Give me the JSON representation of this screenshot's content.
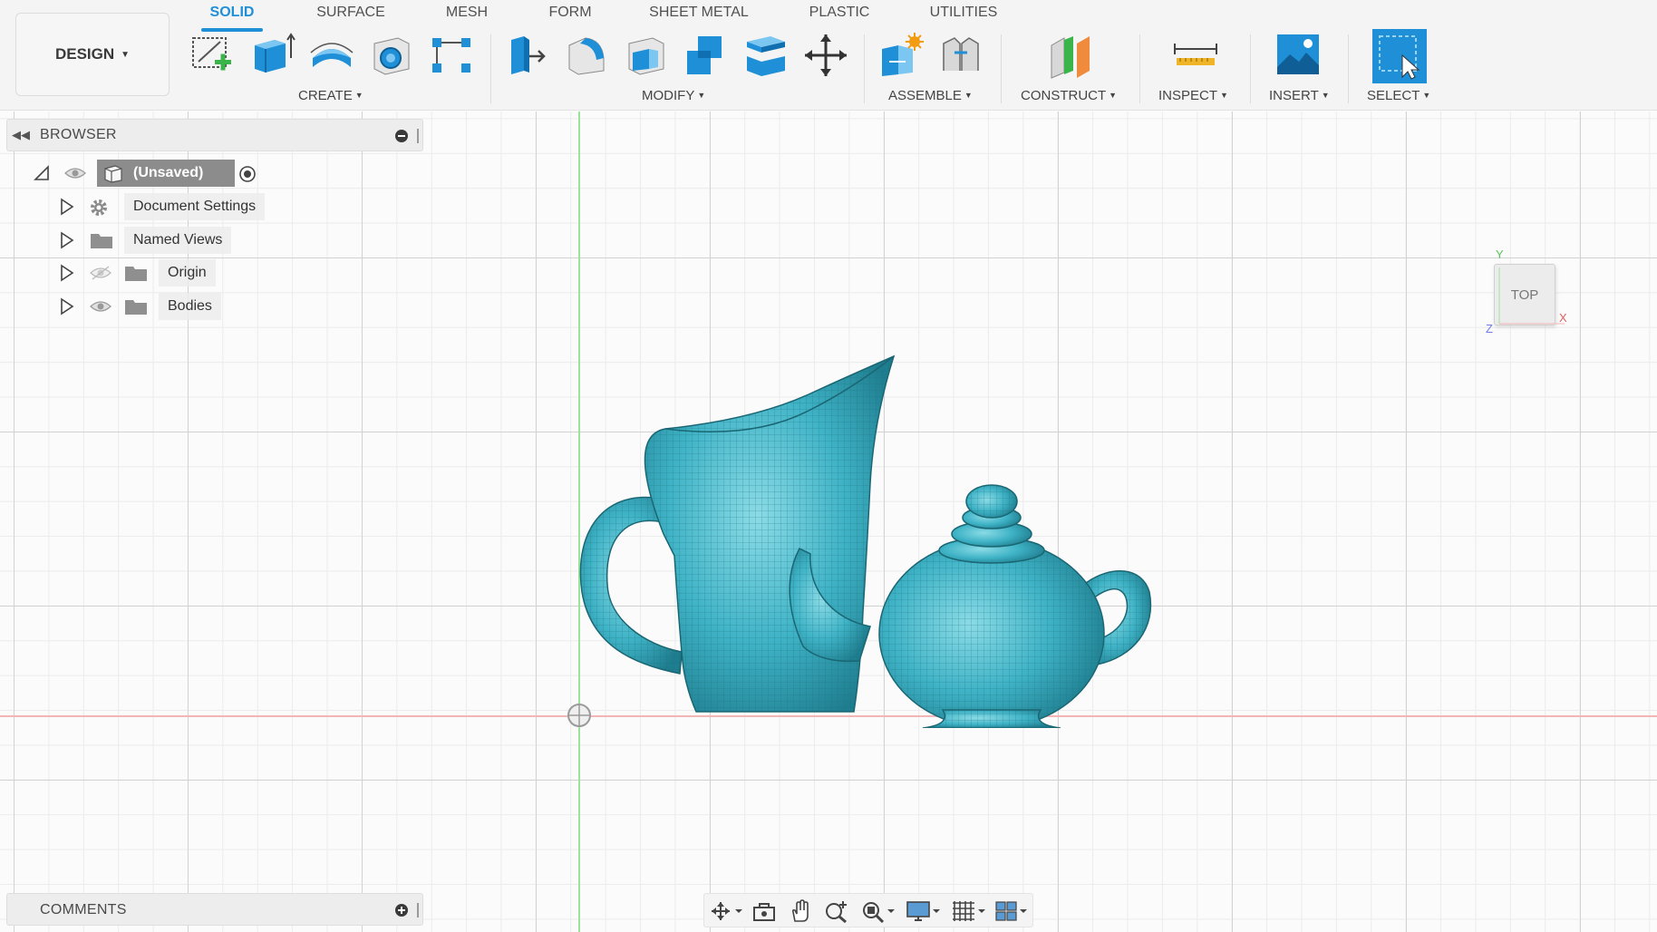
{
  "workspace": {
    "label": "DESIGN"
  },
  "tabs": [
    {
      "label": "SOLID",
      "active": true
    },
    {
      "label": "SURFACE",
      "active": false
    },
    {
      "label": "MESH",
      "active": false
    },
    {
      "label": "FORM",
      "active": false
    },
    {
      "label": "SHEET METAL",
      "active": false
    },
    {
      "label": "PLASTIC",
      "active": false
    },
    {
      "label": "UTILITIES",
      "active": false
    }
  ],
  "groups": {
    "create": "CREATE",
    "modify": "MODIFY",
    "assemble": "ASSEMBLE",
    "construct": "CONSTRUCT",
    "inspect": "INSPECT",
    "insert": "INSERT",
    "select": "SELECT"
  },
  "tools": {
    "create": [
      "new-sketch-icon",
      "extrude-icon",
      "revolve-icon",
      "hole-icon",
      "pattern-icon"
    ],
    "modify": [
      "press-pull-icon",
      "fillet-icon",
      "shell-icon",
      "combine-icon",
      "offset-face-icon",
      "move-icon"
    ],
    "assemble": [
      "new-component-icon",
      "joint-icon"
    ],
    "construct": [
      "offset-plane-icon"
    ],
    "inspect": [
      "measure-icon"
    ],
    "insert": [
      "insert-image-icon"
    ],
    "select": [
      "select-icon"
    ]
  },
  "browser": {
    "title": "BROWSER",
    "root": {
      "label": "(Unsaved)"
    },
    "items": [
      {
        "label": "Document Settings"
      },
      {
        "label": "Named Views"
      },
      {
        "label": "Origin"
      },
      {
        "label": "Bodies"
      }
    ]
  },
  "comments": {
    "title": "COMMENTS"
  },
  "view_cube": {
    "face": "TOP",
    "axes": {
      "x": "X",
      "y": "Y",
      "z": "Z"
    }
  },
  "colors": {
    "accent": "#1f8fd8",
    "model": "#3fb3c6",
    "axis_x": "#f2b6b6",
    "axis_y": "#9be39b"
  },
  "navbar": [
    "orbit-icon",
    "look-at-icon",
    "pan-icon",
    "zoom-icon",
    "fit-icon",
    "display-settings-icon",
    "grid-settings-icon",
    "viewports-icon"
  ]
}
